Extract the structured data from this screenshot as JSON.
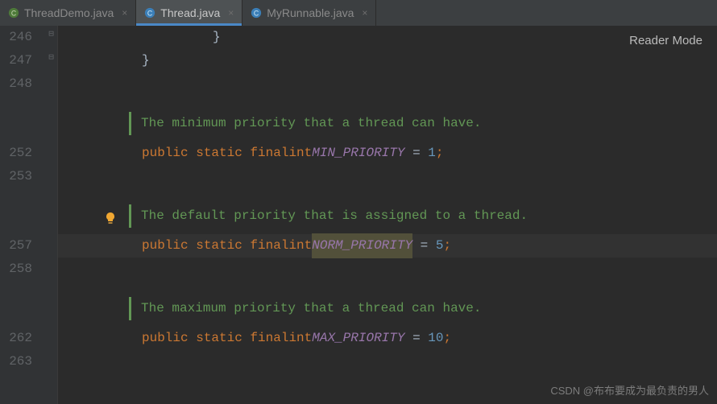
{
  "tabs": [
    {
      "label": "ThreadDemo.java",
      "active": false,
      "icon": "class"
    },
    {
      "label": "Thread.java",
      "active": true,
      "icon": "class"
    },
    {
      "label": "MyRunnable.java",
      "active": false,
      "icon": "class"
    }
  ],
  "reader_mode": "Reader Mode",
  "lines": [
    {
      "num": "246",
      "type": "brace",
      "text": "}",
      "indent": 16
    },
    {
      "num": "247",
      "type": "brace",
      "text": "}",
      "indent": 8
    },
    {
      "num": "248",
      "type": "blank"
    },
    {
      "num": "",
      "type": "doc",
      "text": "The minimum priority that a thread can have."
    },
    {
      "num": "252",
      "type": "code",
      "indent": 8,
      "kw": "public static final",
      "ty": "int",
      "name": "MIN_PRIORITY",
      "eq": " = ",
      "val": "1",
      "semi": ";"
    },
    {
      "num": "253",
      "type": "blank"
    },
    {
      "num": "",
      "type": "doc",
      "text": "The default priority that is assigned to a thread.",
      "bulb": true
    },
    {
      "num": "257",
      "type": "code",
      "indent": 8,
      "kw": "public static final",
      "ty": "int",
      "name": "NORM_PRIORITY",
      "eq": " = ",
      "val": "5",
      "semi": ";",
      "hl": true,
      "nameHl": true
    },
    {
      "num": "258",
      "type": "blank"
    },
    {
      "num": "",
      "type": "doc",
      "text": "The maximum priority that a thread can have."
    },
    {
      "num": "262",
      "type": "code",
      "indent": 8,
      "kw": "public static final",
      "ty": "int",
      "name": "MAX_PRIORITY",
      "eq": " = ",
      "val": "10",
      "semi": ";"
    },
    {
      "num": "263",
      "type": "blank"
    }
  ],
  "watermark": "CSDN @布布要成为最负责的男人"
}
